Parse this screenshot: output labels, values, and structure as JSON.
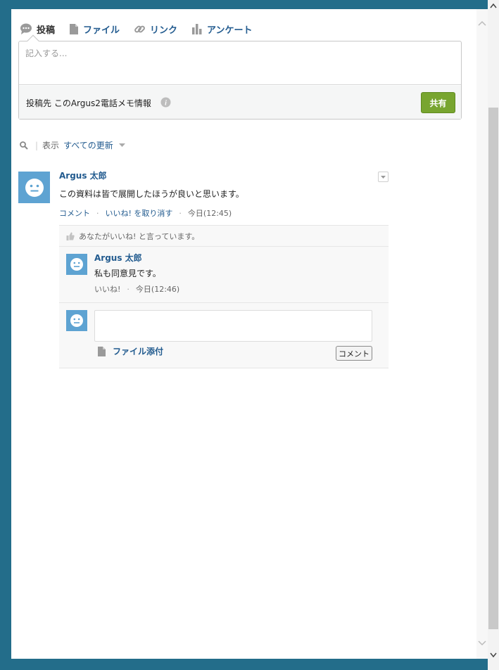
{
  "colors": {
    "frame": "#236d8a",
    "accent": "#225b8f",
    "share": "#78a52f",
    "avatar": "#5ea3d2"
  },
  "tabs": [
    {
      "label": "投稿",
      "icon": "chat-bubble-icon",
      "active": true
    },
    {
      "label": "ファイル",
      "icon": "document-icon"
    },
    {
      "label": "リンク",
      "icon": "link-icon"
    },
    {
      "label": "アンケート",
      "icon": "bar-chart-icon"
    }
  ],
  "composer": {
    "placeholder": "記入する...",
    "post_target": "投稿先 このArgus2電話メモ情報",
    "share_label": "共有"
  },
  "filter": {
    "label": "表示",
    "value": "すべての更新"
  },
  "post": {
    "author": "Argus 太郎",
    "text": "この資料は皆で展開したほうが良いと思います。",
    "actions": {
      "comment": "コメント",
      "unlike": "いいね! を取り消す",
      "time": "今日(12:45)"
    }
  },
  "likes_text": "あなたがいいね! と言っています。",
  "comment": {
    "author": "Argus 太郎",
    "text": "私も同意見です。",
    "like": "いいね!",
    "time": "今日(12:46)"
  },
  "reply": {
    "attach_label": "ファイル添付",
    "button_label": "コメント"
  }
}
